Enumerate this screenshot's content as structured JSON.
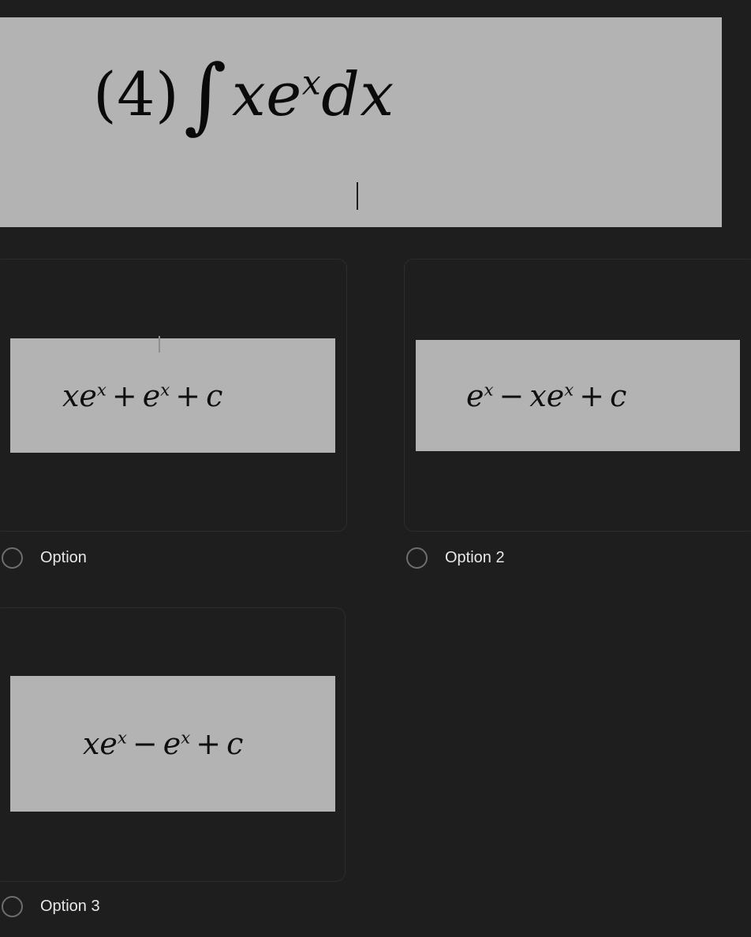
{
  "screen": {
    "background_color": "#1e1e1e",
    "image_background_color": "#b3b3b3",
    "label_text_color": "#e8e8e8",
    "radio_border_color": "#6e6e6e",
    "card_border_color": "#2c2c2c"
  },
  "question": {
    "number": "(4)",
    "integral_symbol": "∫",
    "integrand_base": "xe",
    "integrand_exponent": "x",
    "differential": "dx",
    "full_text": "(4) ∫ xe^x dx"
  },
  "options": [
    {
      "id": "option-1",
      "label": "Option",
      "formula": {
        "term1_base": "xe",
        "term1_exponent": "x",
        "operator1": "+",
        "term2_base": "e",
        "term2_exponent": "x",
        "operator2": "+",
        "constant": "c",
        "full_text": "xe^x + e^x + c"
      },
      "selected": false
    },
    {
      "id": "option-2",
      "label": "Option 2",
      "formula": {
        "term1_base": "e",
        "term1_exponent": "x",
        "operator1": "−",
        "term2_base": "xe",
        "term2_exponent": "x",
        "operator2": "+",
        "constant": "c",
        "full_text": "e^x − xe^x + c"
      },
      "selected": false
    },
    {
      "id": "option-3",
      "label": "Option 3",
      "formula": {
        "term1_base": "xe",
        "term1_exponent": "x",
        "operator1": "−",
        "term2_base": "e",
        "term2_exponent": "x",
        "operator2": "+",
        "constant": "c",
        "full_text": "xe^x − e^x + c"
      },
      "selected": false
    }
  ]
}
